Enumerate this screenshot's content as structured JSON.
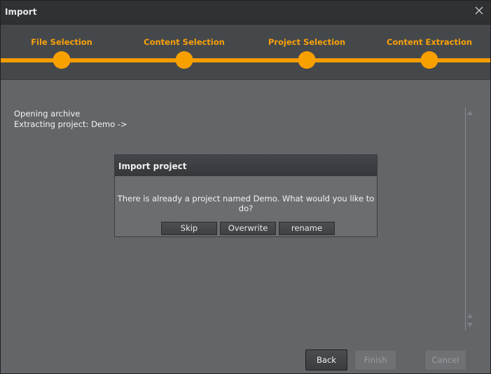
{
  "window": {
    "title": "Import"
  },
  "steps": [
    {
      "label": "File Selection"
    },
    {
      "label": "Content Selection"
    },
    {
      "label": "Project Selection"
    },
    {
      "label": "Content Extraction"
    }
  ],
  "log": {
    "lines": [
      "Opening archive",
      "Extracting project: Demo ->"
    ]
  },
  "dialog": {
    "title": "Import project",
    "message": "There is already a project named Demo. What would you like to do?",
    "buttons": {
      "skip": "Skip",
      "overwrite": "Overwrite",
      "rename": "rename"
    }
  },
  "footer": {
    "back": "Back",
    "finish": "Finish",
    "cancel": "Cancel"
  },
  "colors": {
    "accent": "#f7a000",
    "window_bg": "#636669",
    "titlebar_bg": "#2f3133"
  },
  "icons": {
    "close": "close-icon",
    "scroll_up": "chevron-up-icon",
    "scroll_down": "chevron-down-icon"
  }
}
